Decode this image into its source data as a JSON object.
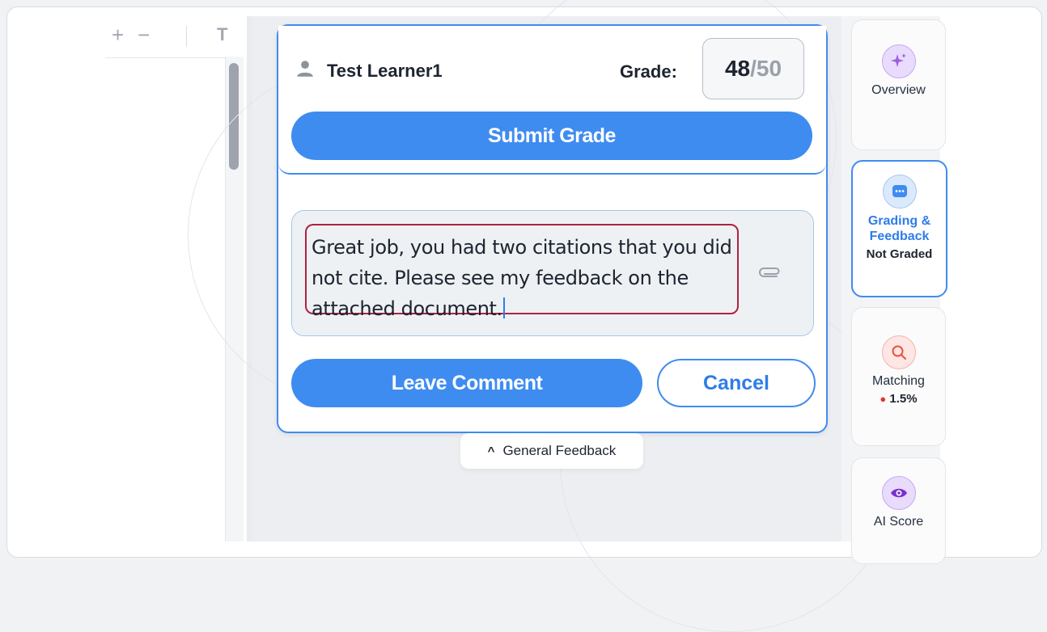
{
  "toolbar": {
    "zoom_in_icon": "plus-icon",
    "zoom_out_icon": "minus-icon",
    "text_tool_icon": "text-icon"
  },
  "comment_popup": {
    "learner_name": "Test Learner1",
    "grade_label": "Grade:",
    "grade_score": "48",
    "grade_separator": "/",
    "grade_max": "50",
    "submit_label": "Submit Grade",
    "feedback_text": "Great job, you had two citations that you did not cite. Please see my feedback on the attached document.",
    "leave_comment_label": "Leave Comment",
    "cancel_label": "Cancel"
  },
  "general_feedback": {
    "label": "General Feedback"
  },
  "side_nav": {
    "overview": {
      "label": "Overview"
    },
    "grading": {
      "label_line1": "Grading &",
      "label_line2": "Feedback",
      "status": "Not Graded"
    },
    "matching": {
      "label": "Matching",
      "value": "1.5%",
      "status_color": "#e5352f"
    },
    "ai": {
      "label": "AI Score"
    }
  },
  "colors": {
    "accent": "#3f8cf0",
    "highlight_border": "#b0213f"
  }
}
